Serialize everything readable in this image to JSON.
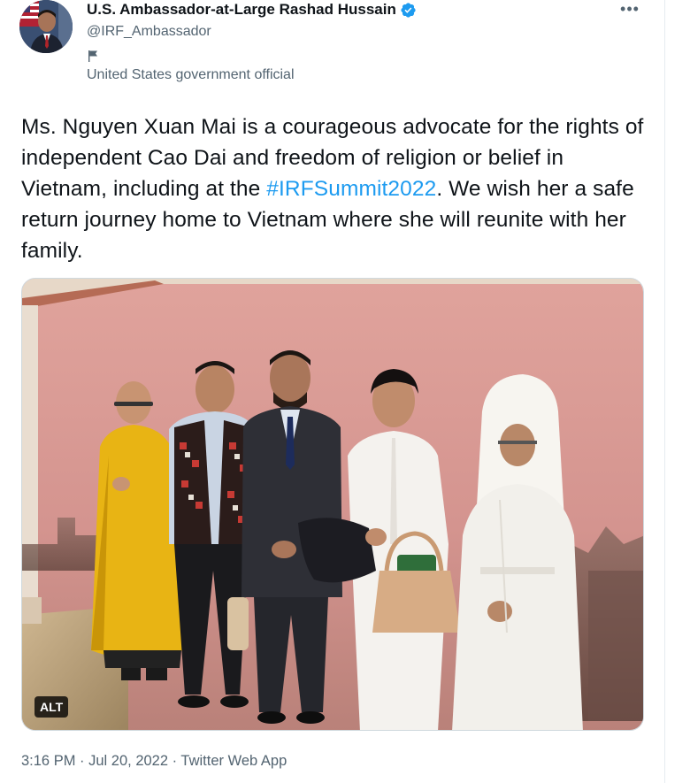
{
  "author": {
    "display_name": "U.S. Ambassador-at-Large Rashad Hussain",
    "handle": "@IRF_Ambassador",
    "label": "United States government official",
    "avatar": "avatar-portrait",
    "verified_icon": "verified-badge-icon",
    "label_icon": "government-flag-icon"
  },
  "menu": {
    "more_icon": "more-options-icon",
    "more_glyph": "•••"
  },
  "tweet": {
    "text_before": "Ms. Nguyen Xuan Mai is a courageous advocate for the rights of independent Cao Dai and freedom of religion or belief in Vietnam, including at the ",
    "hashtag": "#IRFSummit2022",
    "text_after": ". We wish her a safe return journey home to Vietnam where she will reunite with her family."
  },
  "media": {
    "type": "photo",
    "alt_label": "ALT"
  },
  "footer": {
    "time": "3:16 PM",
    "separator": " · ",
    "date": "Jul 20, 2022",
    "source": "Twitter Web App"
  },
  "colors": {
    "accent": "#1d9bf0",
    "text_primary": "#0f1419",
    "text_secondary": "#536471",
    "wall": "#d89a96"
  }
}
